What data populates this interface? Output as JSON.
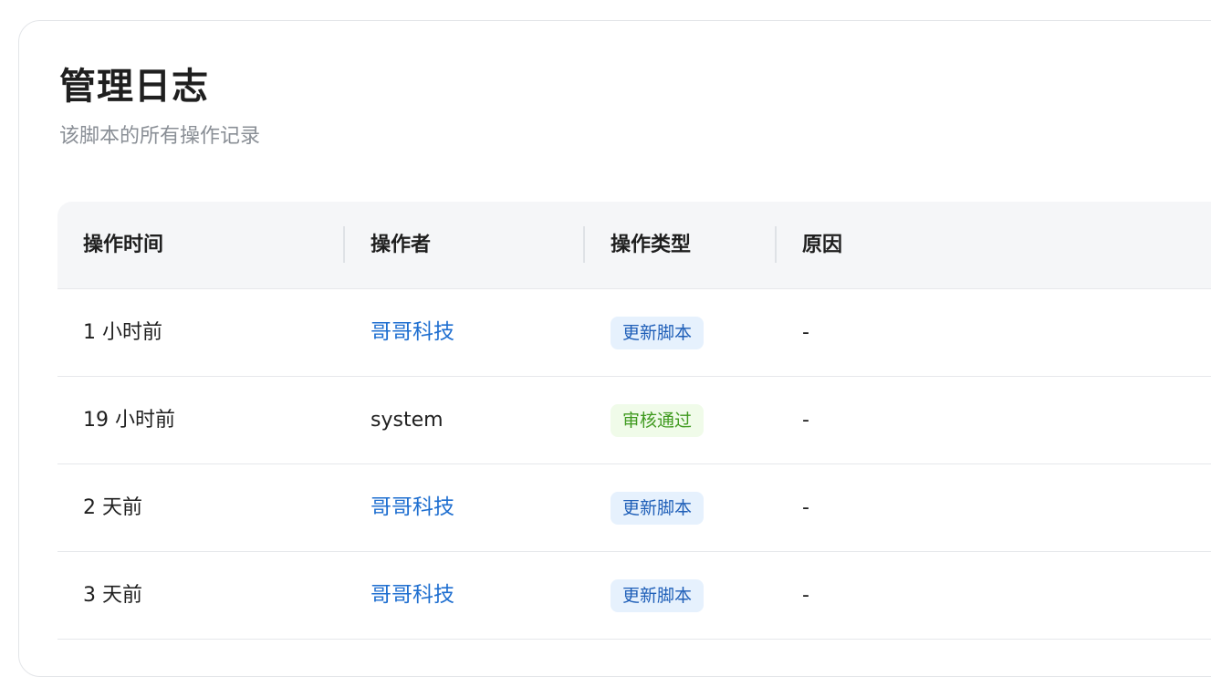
{
  "header": {
    "title": "管理日志",
    "subtitle": "该脚本的所有操作记录"
  },
  "table": {
    "columns": [
      "操作时间",
      "操作者",
      "操作类型",
      "原因"
    ],
    "rows": [
      {
        "time": "1 小时前",
        "operator": "哥哥科技",
        "operator_is_link": true,
        "action": "更新脚本",
        "action_color": "#1f5fb8",
        "reason": "-"
      },
      {
        "time": "19 小时前",
        "operator": "system",
        "operator_is_link": false,
        "action": "审核通过",
        "action_color": "#3f9a1f",
        "reason": "-"
      },
      {
        "time": "2 天前",
        "operator": "哥哥科技",
        "operator_is_link": true,
        "action": "更新脚本",
        "action_color": "#1f5fb8",
        "reason": "-"
      },
      {
        "time": "3 天前",
        "operator": "哥哥科技",
        "operator_is_link": true,
        "action": "更新脚本",
        "action_color": "#1f5fb8",
        "reason": "-"
      }
    ]
  },
  "colors": {
    "link": "#1f6fd0",
    "tag_blue_bg": "#e6f1fd",
    "tag_green_bg": "#f0fbe9"
  }
}
